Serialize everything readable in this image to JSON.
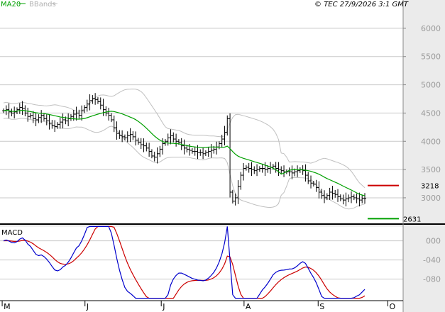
{
  "header": {
    "legend_ma": "MA20",
    "legend_bb": "BBands",
    "copyright": "© TEC 27/9/2026 3:1 GMT"
  },
  "panels": {
    "macd_title": "MACD"
  },
  "colors": {
    "price_bar": "#000000",
    "ma20": "#00a000",
    "bbands": "#c0c0c0",
    "macd_line": "#0000cc",
    "signal_line": "#cc0000",
    "resistance": "#cc0000",
    "support": "#00a000",
    "grid": "#c8c8c8",
    "side_panel": "#ebebeb"
  },
  "chart_data": [
    {
      "type": "ohlc",
      "name": "price",
      "y_ticks": [
        "6000",
        "5500",
        "5000",
        "4500",
        "4000",
        "3500",
        "3000"
      ],
      "y_tick_values": [
        6000,
        5500,
        5000,
        4500,
        4000,
        3500,
        3000
      ],
      "ylim": [
        2560,
        6350
      ],
      "x_labels": [
        "M",
        "J",
        "J",
        "A",
        "S",
        "O"
      ],
      "x_label_days": [
        2,
        78,
        148,
        224,
        292,
        356
      ],
      "x_range": [
        0,
        370
      ],
      "close": [
        4540,
        4560,
        4520,
        4500,
        4520,
        4560,
        4600,
        4580,
        4500,
        4440,
        4460,
        4400,
        4380,
        4420,
        4460,
        4400,
        4360,
        4320,
        4280,
        4260,
        4300,
        4340,
        4380,
        4360,
        4400,
        4440,
        4480,
        4500,
        4460,
        4540,
        4600,
        4660,
        4720,
        4760,
        4740,
        4700,
        4640,
        4560,
        4500,
        4460,
        4380,
        4240,
        4140,
        4100,
        4080,
        4060,
        4100,
        4120,
        4080,
        4020,
        3980,
        3940,
        3920,
        3880,
        3820,
        3740,
        3720,
        3780,
        3860,
        3960,
        4000,
        4060,
        4100,
        4040,
        4000,
        3980,
        3920,
        3880,
        3860,
        3840,
        3820,
        3820,
        3800,
        3800,
        3780,
        3800,
        3820,
        3840,
        3860,
        3900,
        3960,
        4040,
        4160,
        4400,
        3100,
        2940,
        3000,
        3200,
        3400,
        3520,
        3540,
        3520,
        3500,
        3480,
        3500,
        3520,
        3520,
        3500,
        3520,
        3540,
        3560,
        3520,
        3500,
        3480,
        3460,
        3460,
        3460,
        3440,
        3460,
        3480,
        3500,
        3480,
        3400,
        3300,
        3260,
        3240,
        3180,
        3100,
        3040,
        3000,
        3040,
        3100,
        3080,
        3060,
        3020,
        2980,
        2960,
        2980,
        3000,
        3020,
        3000,
        2980,
        2960,
        2990,
        2990
      ],
      "levels": [
        {
          "label": "3218",
          "value": 3218,
          "color": "#cc0000"
        },
        {
          "label": "2631",
          "value": 2631,
          "color": "#00a000"
        }
      ]
    },
    {
      "type": "line",
      "name": "macd",
      "y_ticks": [
        "000",
        "-040",
        "-080"
      ],
      "y_tick_values": [
        0,
        -40,
        -80
      ],
      "ylim": [
        -122,
        32
      ],
      "series": [
        {
          "name": "MACD",
          "color": "#0000cc"
        },
        {
          "name": "Signal",
          "color": "#cc0000"
        }
      ]
    }
  ]
}
